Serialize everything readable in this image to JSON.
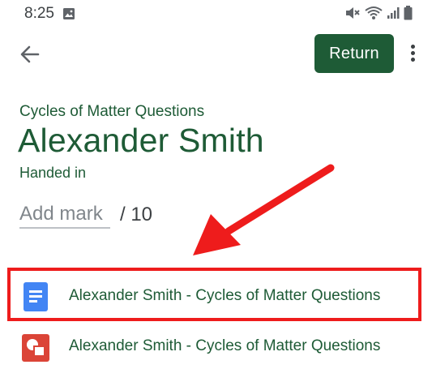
{
  "status_bar": {
    "time": "8:25"
  },
  "header": {
    "return_label": "Return"
  },
  "submission": {
    "assignment_title": "Cycles of Matter Questions",
    "student_name": "Alexander Smith",
    "status": "Handed in",
    "mark_placeholder": "Add mark",
    "out_of": "/ 10"
  },
  "attachments": [
    {
      "label": "Alexander Smith - Cycles of Matter Questions",
      "icon": "google-docs-icon",
      "color": "#4285f4"
    },
    {
      "label": "Alexander Smith - Cycles of Matter Questions",
      "icon": "drawing-icon",
      "color": "#db4437"
    }
  ],
  "colors": {
    "accent": "#1e5b36",
    "highlight": "#ee1c1c"
  }
}
